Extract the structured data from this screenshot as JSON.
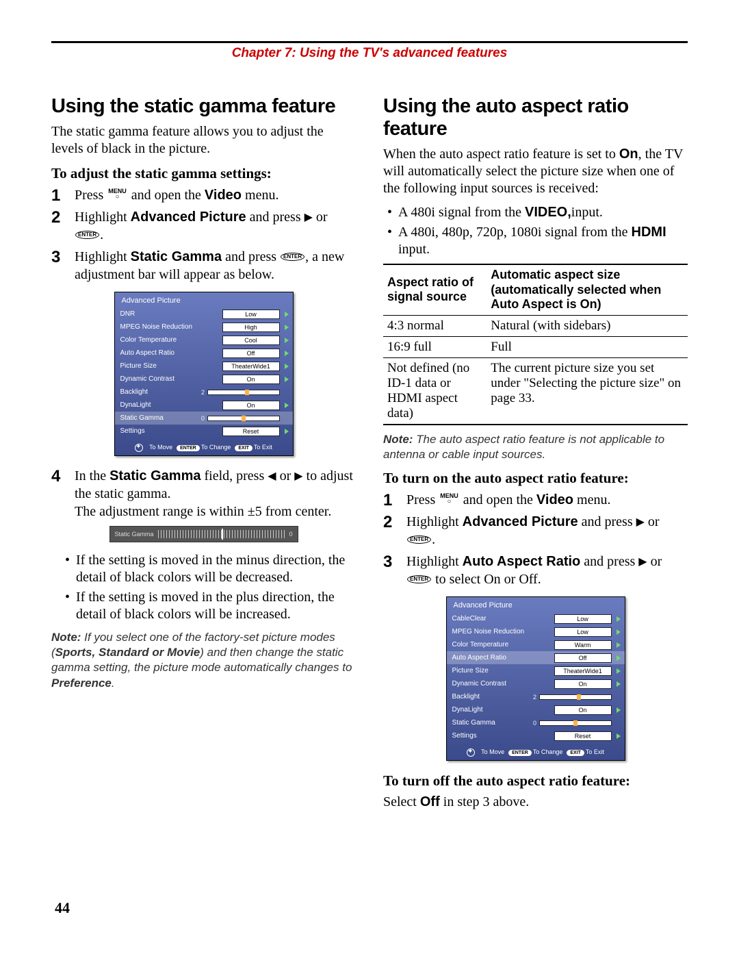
{
  "chapter_header": "Chapter 7: Using the TV's advanced features",
  "page_number": "44",
  "left": {
    "h2": "Using the static gamma feature",
    "intro": "The static gamma feature allows you to adjust the levels of black in the picture.",
    "sub": "To adjust the static gamma settings:",
    "steps": {
      "s1a": "Press ",
      "s1b": " and open the ",
      "s1c": "Video",
      "s1d": " menu.",
      "s2a": "Highlight ",
      "s2b": "Advanced Picture",
      "s2c": " and press ",
      "s2d": " or ",
      "s3a": "Highlight ",
      "s3b": "Static Gamma",
      "s3c": " and press ",
      "s3d": ", a new adjustment bar will appear as below.",
      "s4a": "In the ",
      "s4b": "Static Gamma",
      "s4c": " field, press ",
      "s4d": " or ",
      "s4e": " to adjust the static gamma.",
      "s4f": "The adjustment range is within ±5 from center."
    },
    "bullets": {
      "b1": "If the setting is moved in the minus direction, the detail of black colors will be decreased.",
      "b2": "If the setting is moved in the plus direction, the detail of black colors will be increased."
    },
    "note_pre": "Note:",
    "note": " If you select one of the factory-set picture modes (",
    "note_modes": "Sports, Standard or Movie",
    "note_mid": ") and then change the static gamma setting, the picture mode automatically changes to ",
    "note_pref": "Preference",
    "note_end": ".",
    "osd": {
      "title": "Advanced Picture",
      "rows": [
        {
          "label": "DNR",
          "value": "Low",
          "arrow": true
        },
        {
          "label": "MPEG Noise Reduction",
          "value": "High",
          "arrow": true
        },
        {
          "label": "Color Temperature",
          "value": "Cool",
          "arrow": true
        },
        {
          "label": "Auto Aspect Ratio",
          "value": "Off",
          "arrow": true
        },
        {
          "label": "Picture Size",
          "value": "TheaterWide1",
          "arrow": true
        },
        {
          "label": "Dynamic Contrast",
          "value": "On",
          "arrow": true
        },
        {
          "label": "Backlight",
          "num": "2",
          "slider": 55
        },
        {
          "label": "DynaLight",
          "value": "On",
          "arrow": true
        },
        {
          "label": "Static Gamma",
          "num": "0",
          "slider": 50,
          "sel": true
        },
        {
          "label": "Settings",
          "value": "Reset",
          "arrow": true
        }
      ],
      "hint_move": "To Move",
      "hint_enter_pill": "ENTER",
      "hint_change": "To Change",
      "hint_exit_pill": "EXIT",
      "hint_exit": "To Exit"
    },
    "inline_slider": {
      "label": "Static Gamma",
      "value": "0"
    }
  },
  "right": {
    "h2": "Using the auto aspect ratio feature",
    "intro_a": "When the auto aspect ratio feature is set to ",
    "intro_on": "On",
    "intro_b": ", the TV will automatically select the picture size when one of the following input sources is received:",
    "bul1a": "A 480i signal from the ",
    "bul1b": "VIDEO,",
    "bul1c": "input.",
    "bul2a": "A 480i, 480p, 720p, 1080i signal from the ",
    "bul2b": "HDMI",
    "bul2c": " input.",
    "table": {
      "h1": "Aspect ratio of signal source",
      "h2": "Automatic aspect size (automatically selected when Auto Aspect is On)",
      "r1a": "4:3 normal",
      "r1b": "Natural (with sidebars)",
      "r2a": "16:9 full",
      "r2b": "Full",
      "r3a": "Not defined (no ID-1 data or HDMI aspect data)",
      "r3b": "The current picture size you set under \"Selecting the picture size\" on page 33."
    },
    "note_pre": "Note:",
    "note": " The auto aspect ratio feature is not applicable to antenna or cable input sources.",
    "sub_on": "To turn on the auto aspect ratio feature:",
    "steps": {
      "s1a": "Press ",
      "s1b": " and open the ",
      "s1c": "Video",
      "s1d": " menu.",
      "s2a": "Highlight ",
      "s2b": "Advanced Picture",
      "s2c": " and press ",
      "s2d": " or ",
      "s3a": "Highlight ",
      "s3b": "Auto Aspect Ratio",
      "s3c": " and press ",
      "s3d": " or ",
      "s3e": " to select On or Off."
    },
    "osd": {
      "title": "Advanced Picture",
      "rows": [
        {
          "label": "CableClear",
          "value": "Low",
          "arrow": true
        },
        {
          "label": "MPEG Noise Reduction",
          "value": "Low",
          "arrow": true
        },
        {
          "label": "Color Temperature",
          "value": "Warm",
          "arrow": true
        },
        {
          "label": "Auto Aspect Ratio",
          "value": "Off",
          "arrow": true,
          "sel": true
        },
        {
          "label": "Picture Size",
          "value": "TheaterWide1",
          "arrow": true
        },
        {
          "label": "Dynamic Contrast",
          "value": "On",
          "arrow": true
        },
        {
          "label": "Backlight",
          "num": "2",
          "slider": 55
        },
        {
          "label": "DynaLight",
          "value": "On",
          "arrow": true
        },
        {
          "label": "Static Gamma",
          "num": "0",
          "slider": 50
        },
        {
          "label": "Settings",
          "value": "Reset",
          "arrow": true
        }
      ]
    },
    "sub_off": "To turn off the auto aspect ratio feature:",
    "off_body_a": "Select ",
    "off_body_b": "Off",
    "off_body_c": " in step 3 above."
  },
  "glyphs": {
    "menu": "MENU",
    "enter": "ENTER",
    "right": "▶",
    "left": "◀"
  }
}
